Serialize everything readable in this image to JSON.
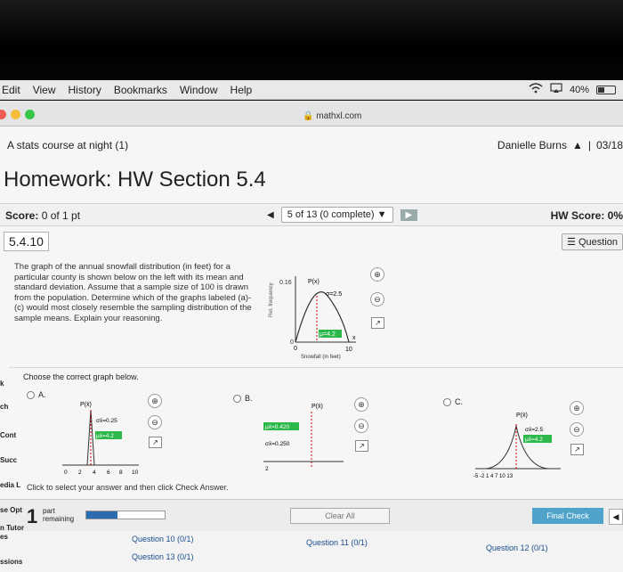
{
  "menubar": {
    "items": [
      "Edit",
      "View",
      "History",
      "Bookmarks",
      "Window",
      "Help"
    ],
    "battery": "40%"
  },
  "browser": {
    "url": "mathxl.com"
  },
  "header": {
    "course": "A stats course at night (1)",
    "user": "Danielle Burns",
    "date": "03/18"
  },
  "homework": {
    "title": "Homework: HW Section 5.4"
  },
  "scorebar": {
    "score_label": "Score:",
    "score_value": "0 of 1 pt",
    "nav_label": "5 of 13 (0 complete)",
    "hw_score": "HW Score: 0%"
  },
  "question": {
    "number": "5.4.10",
    "help": "Question",
    "text": "The graph of the annual snowfall distribution (in feet) for a particular county is shown below on the left with its mean and standard deviation. Assume that a sample size of 100 is drawn from the population. Determine which of the graphs labeled (a)-(c) would most closely resemble the sampling distribution of the sample means. Explain your reasoning."
  },
  "main_graph": {
    "ylabel": "Rel. frequency",
    "ytop": "0.16",
    "ybottom": "0",
    "ptitle": "P(x)",
    "sigma": "σ=2.5",
    "mu": "μ=4.2",
    "xmax": "10",
    "xmin": "0",
    "xvar": "x",
    "xlabel": "Snowfall (in feet)"
  },
  "choices": {
    "prompt": "Choose the correct graph below.",
    "a": {
      "label": "A.",
      "ptitle": "P(x̄)",
      "sigma": "σx̄=0.25",
      "mu": "μx̄=4.2",
      "ticks": [
        "0",
        "2",
        "4",
        "6",
        "8",
        "10"
      ]
    },
    "b": {
      "label": "B.",
      "ptitle": "P(x̄)",
      "mu": "μx̄=0.420",
      "sigma": "σx̄=0.250",
      "tick": "2"
    },
    "c": {
      "label": "C.",
      "ptitle": "P(x̄)",
      "sigma": "σx̄=2.5",
      "mu": "μx̄=4.2",
      "ticks": "-5 -2 1 4 7 10 13"
    }
  },
  "hint": "Click to select your answer and then click Check Answer.",
  "part": {
    "number": "1",
    "label_line1": "part",
    "label_line2": "remaining",
    "progress": 0.4
  },
  "buttons": {
    "clear_all": "Clear All",
    "final_check": "Final Check"
  },
  "questions": {
    "q10": "Question 10 (0/1)",
    "q11": "Question 11 (0/1)",
    "q12": "Question 12 (0/1)",
    "q13": "Question 13 (0/1)"
  },
  "sidebar_cut": {
    "k": "k",
    "ch": "ch",
    "es": "es",
    "cont": "Cont",
    "succ": "Succ",
    "edia": "edia L",
    "seopt": "se Opt",
    "tutor": "n Tutor",
    "es2": "es",
    "ssions": "ssions"
  }
}
